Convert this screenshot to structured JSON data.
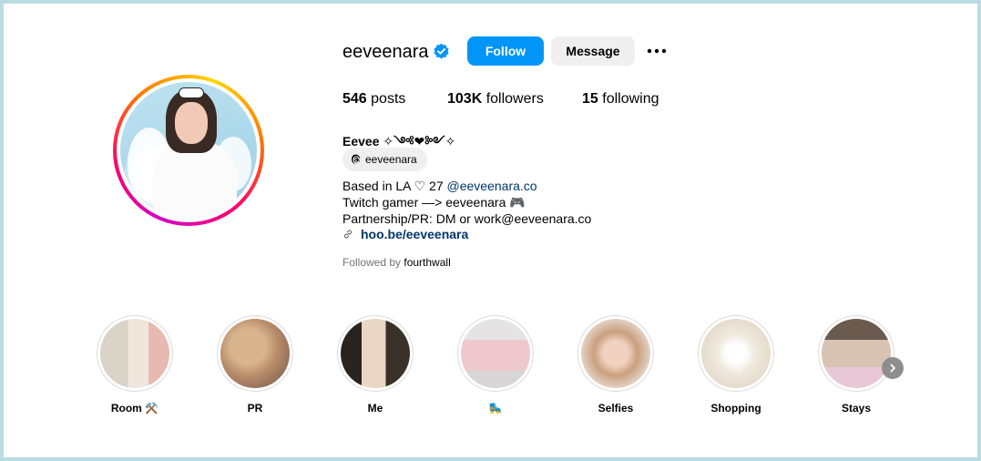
{
  "profile": {
    "username": "eeveenara",
    "follow_label": "Follow",
    "message_label": "Message",
    "stats": {
      "posts_count": "546",
      "posts_label": "posts",
      "followers_count": "103K",
      "followers_label": "followers",
      "following_count": "15",
      "following_label": "following"
    },
    "full_name": "Eevee ✧༺❤︎༻✧",
    "threads_handle": "eeveenara",
    "bio": {
      "line1_text": "Based in LA ♡ 27 ",
      "line1_mention": "@eeveenara.co",
      "line2": "Twitch gamer —> eeveenara 🎮",
      "line3": "Partnership/PR: DM or work@eeveenara.co"
    },
    "website": "hoo.be/eeveenara",
    "followed_by_prefix": "Followed by ",
    "followed_by_user": "fourthwall"
  },
  "highlights": [
    {
      "label": "Room ⚒️"
    },
    {
      "label": "PR"
    },
    {
      "label": "Me"
    },
    {
      "label": "🛼"
    },
    {
      "label": "Selfies"
    },
    {
      "label": "Shopping"
    },
    {
      "label": "Stays"
    }
  ],
  "colors": {
    "accent": "#0095f6",
    "link": "#00376b",
    "secondary_button": "#efefef",
    "muted_text": "#737373",
    "frame_border": "#b9dce3"
  },
  "icons": [
    "verified-badge-icon",
    "more-options-icon",
    "threads-icon",
    "link-icon",
    "chevron-right-icon"
  ]
}
